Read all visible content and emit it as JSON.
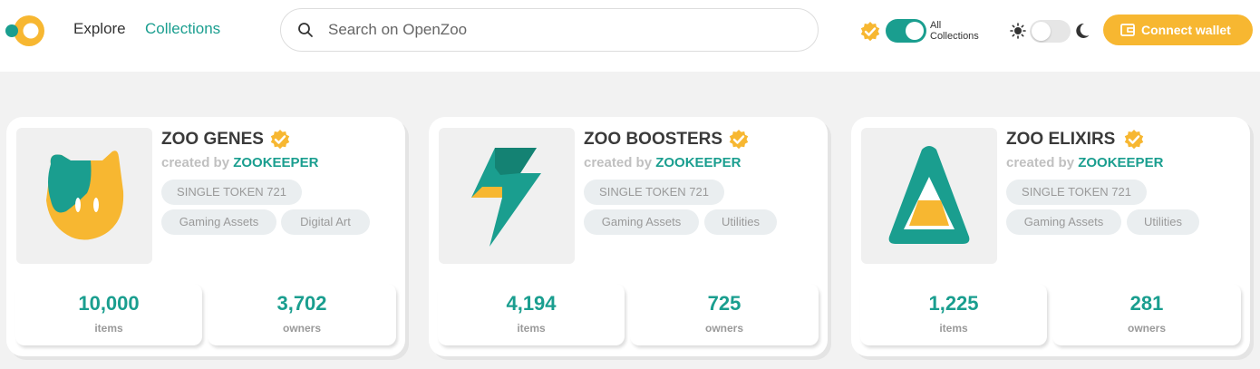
{
  "header": {
    "nav": {
      "explore": "Explore",
      "collections": "Collections"
    },
    "search": {
      "placeholder": "Search on OpenZoo"
    },
    "filter_label": "All Collections",
    "connect_label": "Connect wallet"
  },
  "colors": {
    "accent": "#1a9e8f",
    "gold": "#f7b731",
    "tag_bg": "#eaeef0"
  },
  "collections": [
    {
      "name": "ZOO GENES",
      "created_by_prefix": "created by",
      "creator": "ZOOKEEPER",
      "standard": "SINGLE TOKEN 721",
      "tags": [
        "Gaming Assets",
        "Digital Art"
      ],
      "items": "10,000",
      "items_label": "items",
      "owners": "3,702",
      "owners_label": "owners",
      "icon": "cat-face-icon"
    },
    {
      "name": "ZOO BOOSTERS",
      "created_by_prefix": "created by",
      "creator": "ZOOKEEPER",
      "standard": "SINGLE TOKEN 721",
      "tags": [
        "Gaming Assets",
        "Utilities"
      ],
      "items": "4,194",
      "items_label": "items",
      "owners": "725",
      "owners_label": "owners",
      "icon": "lightning-bolt-icon"
    },
    {
      "name": "ZOO ELIXIRS",
      "created_by_prefix": "created by",
      "creator": "ZOOKEEPER",
      "standard": "SINGLE TOKEN 721",
      "tags": [
        "Gaming Assets",
        "Utilities"
      ],
      "items": "1,225",
      "items_label": "items",
      "owners": "281",
      "owners_label": "owners",
      "icon": "elixir-flask-icon"
    }
  ]
}
